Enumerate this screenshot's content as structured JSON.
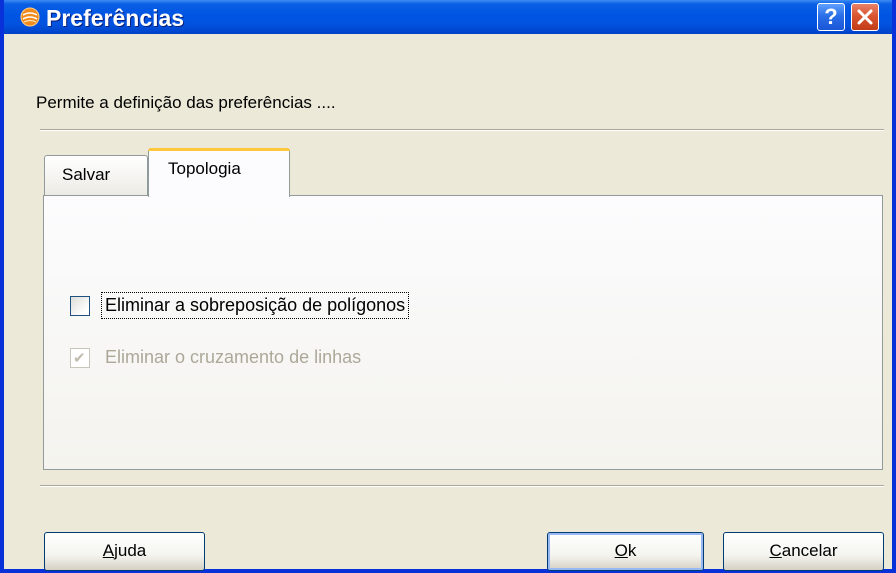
{
  "window": {
    "title": "Preferências",
    "help_label": "?",
    "close_label": "✕",
    "icon": "app-orange-globe-icon"
  },
  "description": "Permite a definição das preferências ....",
  "tabs": [
    {
      "label": "Salvar",
      "active": false
    },
    {
      "label": "Topologia",
      "active": true
    }
  ],
  "options": [
    {
      "label": "Eliminar a sobreposição de polígonos",
      "checked": false,
      "enabled": true,
      "focused": true
    },
    {
      "label": "Eliminar o cruzamento de linhas",
      "checked": true,
      "enabled": false
    }
  ],
  "buttons": {
    "help": {
      "mnemonic": "A",
      "rest": "juda"
    },
    "ok": {
      "mnemonic": "O",
      "rest": "k"
    },
    "cancel": {
      "mnemonic": "C",
      "rest": "ancelar"
    }
  },
  "colors": {
    "titlebar": "#0054e3",
    "dialog_bg": "#ece9d8",
    "active_tab_highlight": "#ffc83c",
    "close_button": "#d9552f",
    "disabled_text": "#aca899"
  }
}
